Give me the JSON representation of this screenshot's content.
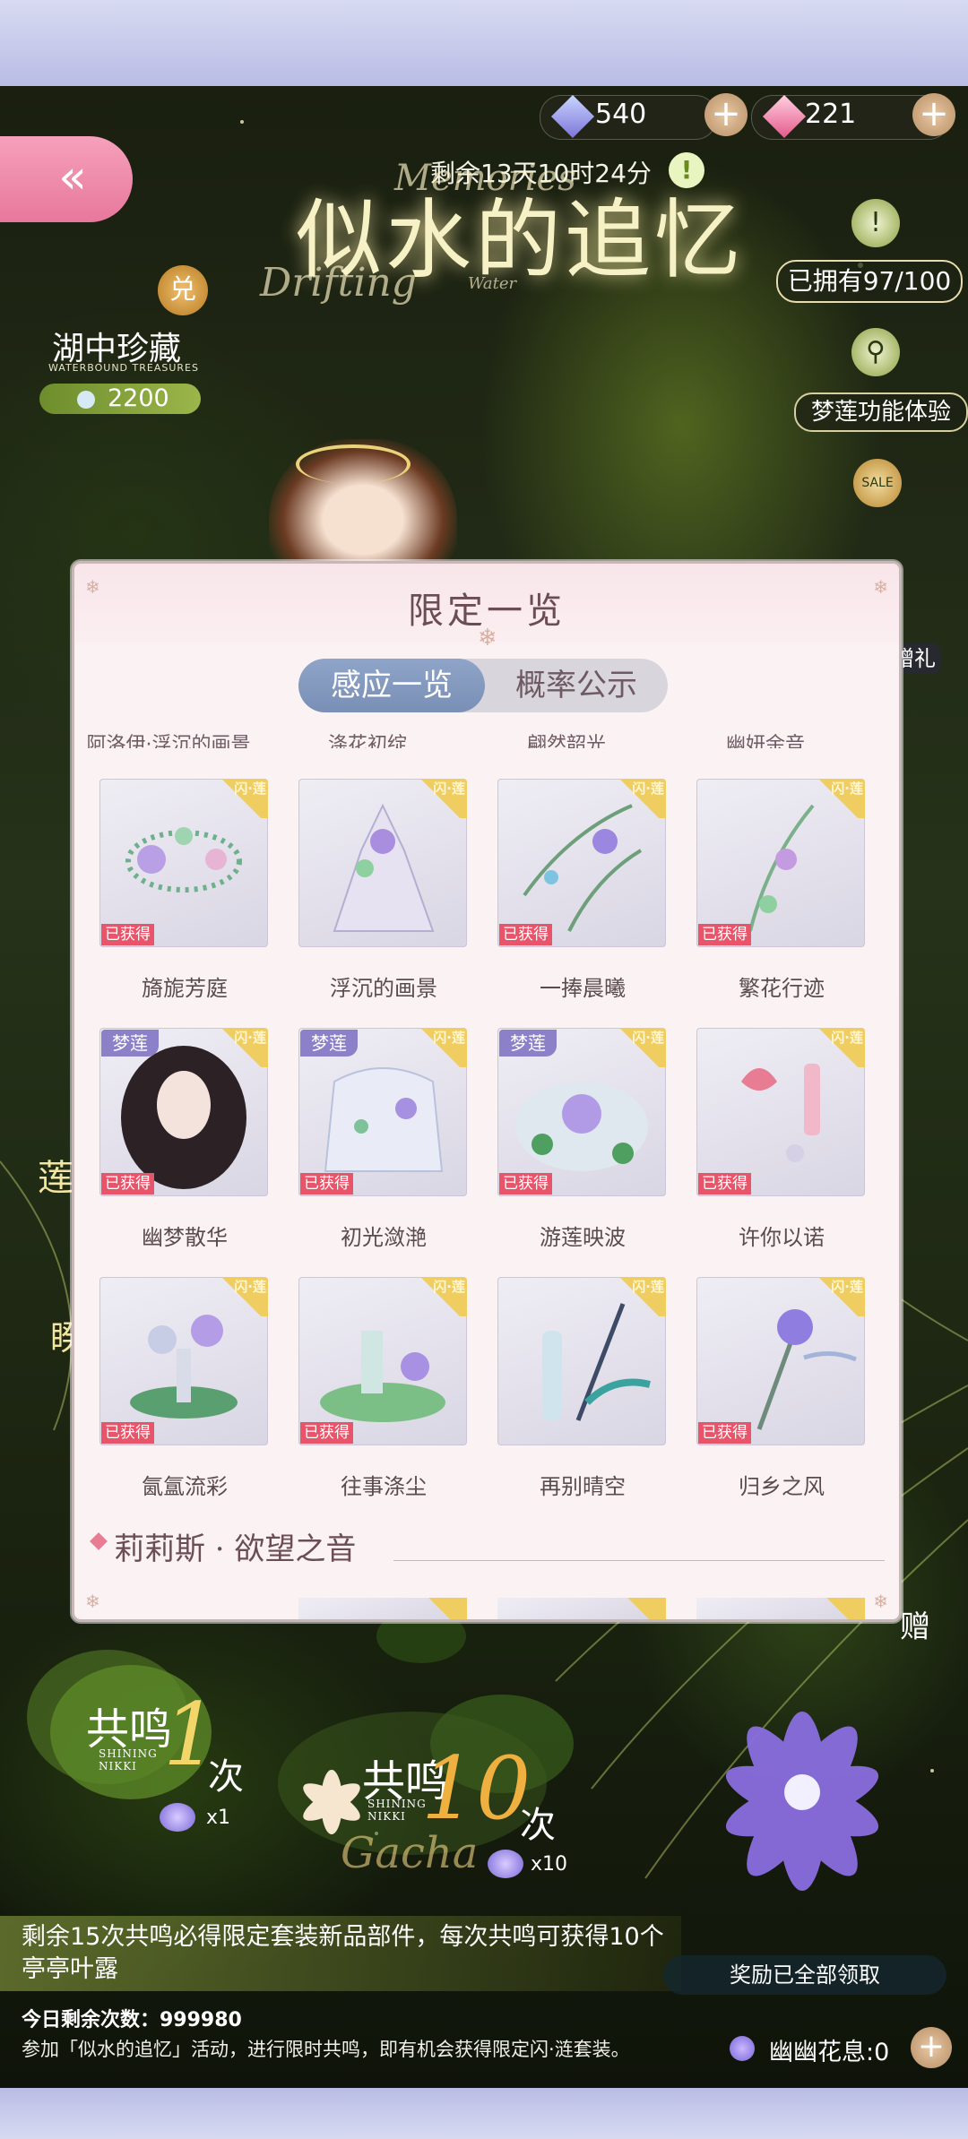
{
  "currency": {
    "diamond_blue": "540",
    "diamond_pink": "221"
  },
  "header": {
    "back_symbol": "«",
    "timer": "剩余13天10时24分",
    "warn_symbol": "!",
    "event_title": "似水的追忆",
    "event_title_en_1": "Memories",
    "event_title_en_2": "Drifting",
    "event_title_en_3": "Water",
    "owned": "已拥有97/100",
    "feature_trial": "梦莲功能体验",
    "gift_label": "赠礼",
    "treasure_label": "湖中珍藏",
    "treasure_en": "WATERBOUND TREASURES",
    "treasure_badge": "兑",
    "treasure_coins": "2200",
    "sale_label": "SALE",
    "left_deco": "莲",
    "left_deco2": "睽",
    "right_deco": "赠"
  },
  "panel": {
    "title": "限定一览",
    "tabs": [
      "感应一览",
      "概率公示"
    ],
    "cut_names": [
      "阿洛伊·浮沉的画景",
      "涤花初绽",
      "翩然韶光",
      "幽妍余音"
    ],
    "items": [
      {
        "name": "旖旎芳庭",
        "status": "已获得",
        "tag": ""
      },
      {
        "name": "浮沉的画景",
        "status": "已获得",
        "tag": ""
      },
      {
        "name": "一捧晨曦",
        "status": "已获得",
        "tag": ""
      },
      {
        "name": "繁花行迹",
        "status": "已获得",
        "tag": ""
      },
      {
        "name": "幽梦散华",
        "status": "已获得",
        "tag": "梦莲"
      },
      {
        "name": "初光潋滟",
        "status": "已获得",
        "tag": "梦莲"
      },
      {
        "name": "游莲映波",
        "status": "已获得",
        "tag": "梦莲"
      },
      {
        "name": "许你以诺",
        "status": "已获得",
        "tag": ""
      },
      {
        "name": "氤氲流彩",
        "status": "已获得",
        "tag": ""
      },
      {
        "name": "往事涤尘",
        "status": "已获得",
        "tag": ""
      },
      {
        "name": "再别晴空",
        "status": "",
        "tag": ""
      },
      {
        "name": "归乡之风",
        "status": "已获得",
        "tag": ""
      }
    ],
    "corner_label": "闪·莲",
    "section_title": "莉莉斯 · 欲望之音"
  },
  "gacha": {
    "single_title": "共鸣",
    "single_en": "SHINING NIKKI",
    "single_count": "1",
    "single_unit": "次",
    "single_cost": "x1",
    "ten_title": "共鸣",
    "ten_en": "SHINING NIKKI",
    "ten_count": "10",
    "ten_unit": "次",
    "ten_cost": "x10",
    "ten_script": "Gacha"
  },
  "footer": {
    "guarantee": "剩余15次共鸣必得限定套装新品部件，每次共鸣可获得10个亭亭叶露",
    "rewards_claimed": "奖励已全部领取",
    "today_left": "今日剩余次数：999980",
    "description": "参加「似水的追忆」活动，进行限时共鸣，即有机会获得限定闪·涟套装。",
    "youyou_label": "幽幽花息:0"
  },
  "colors": {
    "accent_pink": "#e7789c",
    "tab_active": "#7a8fb5",
    "obtained_red": "#e8546a",
    "lotus_purple": "#8c80c8",
    "gold": "#f0cd60"
  }
}
